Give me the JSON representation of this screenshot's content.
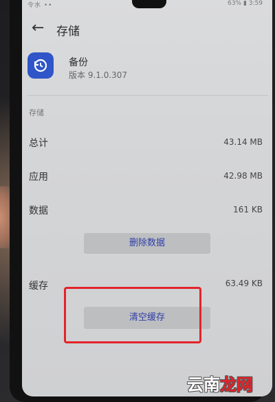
{
  "statusbar": {
    "left_text": "令水 ••",
    "right_text": "63% ▮ 3:59"
  },
  "appbar": {
    "back_icon": "arrow-left-icon",
    "title": "存储"
  },
  "app": {
    "icon": "backup-icon",
    "name": "备份",
    "version": "版本 9.1.0.307"
  },
  "storage": {
    "section_label": "存储",
    "rows": [
      {
        "label": "总计",
        "value": "43.14 MB"
      },
      {
        "label": "应用",
        "value": "42.98 MB"
      },
      {
        "label": "数据",
        "value": "161 KB"
      }
    ],
    "delete_button": "删除数据"
  },
  "cache": {
    "label": "缓存",
    "value": "63.49 KB",
    "clear_button": "清空缓存"
  },
  "watermark": {
    "part1": "云南",
    "part2": "龙网"
  },
  "colors": {
    "accent": "#2f3fa6",
    "highlight": "#e3232a",
    "app_icon_bg": "#2f55c8"
  }
}
